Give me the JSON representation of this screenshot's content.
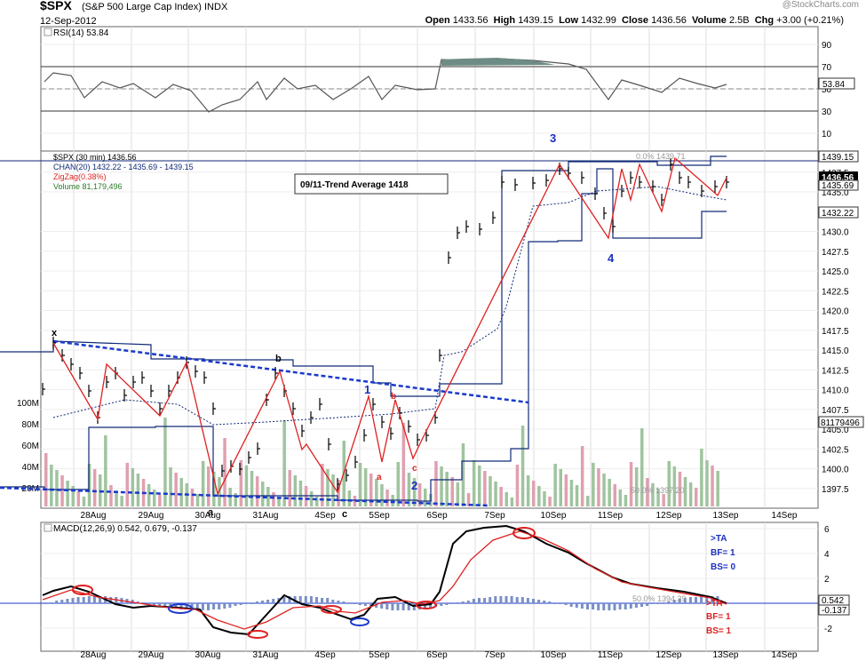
{
  "header": {
    "symbol": "$SPX",
    "name": "(S&P 500 Large Cap Index) INDX",
    "date": "12-Sep-2012",
    "brand": "@StockCharts.com",
    "open_label": "Open",
    "open": "1433.56",
    "high_label": "High",
    "high": "1439.15",
    "low_label": "Low",
    "low": "1432.99",
    "close_label": "Close",
    "close": "1436.56",
    "volume_label": "Volume",
    "volume": "2.5B",
    "chg_label": "Chg",
    "chg": "+3.00 (+0.21%)"
  },
  "rsi_panel": {
    "legend": "RSI(14) 53.84",
    "value_tag": "53.84",
    "ticks": [
      "90",
      "70",
      "50",
      "30",
      "10"
    ]
  },
  "price_panel": {
    "legend": [
      "$SPX (30 min) 1436.56",
      "CHAN(20) 1432.22 - 1435.69 - 1439.15",
      "ZigZag(0.38%)",
      "Volume 81,179,496"
    ],
    "ticks": [
      "1437.5",
      "1435.0",
      "1430.0",
      "1427.5",
      "1425.0",
      "1422.5",
      "1420.0",
      "1417.5",
      "1415.0",
      "1412.5",
      "1410.0",
      "1407.5",
      "1405.0",
      "1402.5",
      "1400.0",
      "1397.5"
    ],
    "price_tags": [
      "1439.15",
      "1436.56",
      "1435.69",
      "1432.22"
    ],
    "volume_tag": "81179496",
    "volume_ticks": [
      "100M",
      "80M",
      "60M",
      "40M",
      "20M"
    ],
    "note_box": "09/11-Trend Average 1418",
    "fib_top": "0.0% 1439.71",
    "fib_bottom": "50.0% 1397.20",
    "wave_labels": [
      "x",
      "b",
      "a",
      "c",
      "1",
      "2",
      "a",
      "b",
      "c",
      "3",
      "4"
    ]
  },
  "macd_panel": {
    "legend": "MACD(12,26,9) 0.542, 0.679, -0.137",
    "ticks": [
      "6",
      "4",
      "2",
      "0",
      "-2"
    ],
    "value_tags": [
      "0.542",
      "-0.137"
    ],
    "fib_label": "50.0% 1394.39",
    "notes_blue": [
      ">TA",
      "BF= 1",
      "BS= 0"
    ],
    "notes_red": [
      ">TA",
      "BF= 1",
      "BS= 1"
    ]
  },
  "x_axis": [
    "28Aug",
    "29Aug",
    "30Aug",
    "31Aug",
    "4Sep",
    "5Sep",
    "6Sep",
    "7Sep",
    "10Sep",
    "11Sep",
    "12Sep",
    "13Sep",
    "14Sep"
  ],
  "chart_data": {
    "type": "line",
    "title": "$SPX (S&P 500 Large Cap Index) INDX 30 min",
    "x": [
      "28Aug",
      "29Aug",
      "30Aug",
      "31Aug",
      "4Sep",
      "5Sep",
      "6Sep",
      "7Sep",
      "10Sep",
      "11Sep",
      "12Sep"
    ],
    "series": [
      {
        "name": "$SPX (30 min)",
        "values": [
          1410.5,
          1409.5,
          1400.5,
          1407.0,
          1404.0,
          1405.5,
          1418.0,
          1436.0,
          1436.5,
          1433.5,
          1436.56
        ]
      },
      {
        "name": "RSI(14)",
        "values": [
          56,
          45,
          31,
          49,
          43,
          48,
          71,
          73,
          54,
          47,
          53.84
        ]
      },
      {
        "name": "MACD(12,26,9)",
        "values": [
          -0.2,
          -0.6,
          -2.0,
          -0.5,
          -1.5,
          0.2,
          4.5,
          6.2,
          3.5,
          1.2,
          0.542
        ]
      }
    ],
    "ylim": [
      1396,
      1440
    ],
    "grid": true
  }
}
